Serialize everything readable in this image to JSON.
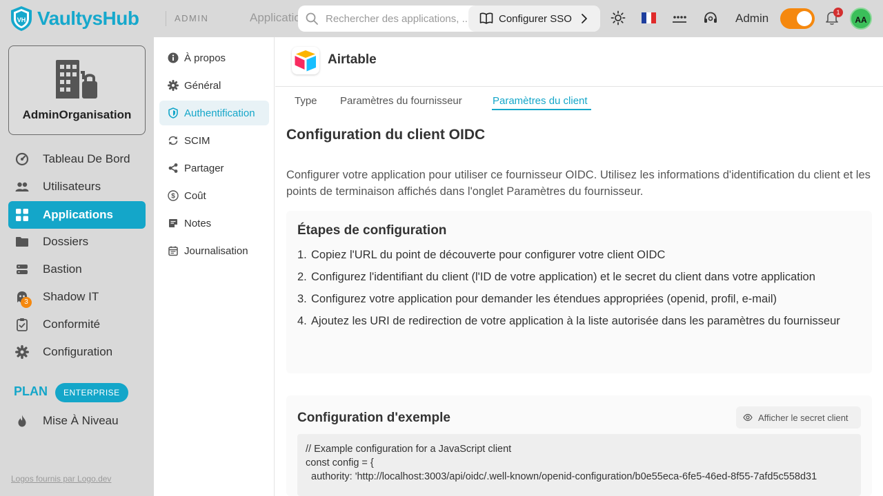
{
  "topbar": {
    "brand": "VaultysHub",
    "section_tag": "ADMIN",
    "breadcrumb": "Applications",
    "search_placeholder": "Rechercher des applications, ...",
    "sso_button": "Configurer SSO",
    "flag": "🇫🇷",
    "user_label": "Admin",
    "notification_count": "1",
    "avatar_initials": "AA",
    "icons": [
      "search-icon",
      "book-icon",
      "chevron-right-icon",
      "sun-icon",
      "france-flag-icon",
      "password-icon",
      "support-icon",
      "bell-icon"
    ]
  },
  "sidebar": {
    "org_name": "AdminOrganisation",
    "items": [
      {
        "label": "Tableau De Bord",
        "icon": "dashboard-icon"
      },
      {
        "label": "Utilisateurs",
        "icon": "users-icon"
      },
      {
        "label": "Applications",
        "icon": "apps-grid-icon",
        "active": true
      },
      {
        "label": "Dossiers",
        "icon": "folder-icon"
      },
      {
        "label": "Bastion",
        "icon": "server-icon"
      },
      {
        "label": "Shadow IT",
        "icon": "ghost-icon",
        "badge": "3"
      },
      {
        "label": "Conformité",
        "icon": "clipboard-icon"
      },
      {
        "label": "Configuration",
        "icon": "gear-icon"
      }
    ],
    "plan_label": "PLAN",
    "plan_badge": "ENTERPRISE",
    "upgrade_label": "Mise À Niveau",
    "logo_credit": "Logos fournis par Logo.dev"
  },
  "subnav": {
    "items": [
      {
        "label": "À propos",
        "icon": "info-icon"
      },
      {
        "label": "Général",
        "icon": "gear-icon"
      },
      {
        "label": "Authentification",
        "icon": "shield-icon",
        "active": true
      },
      {
        "label": "SCIM",
        "icon": "sync-icon"
      },
      {
        "label": "Partager",
        "icon": "share-icon"
      },
      {
        "label": "Coût",
        "icon": "dollar-icon"
      },
      {
        "label": "Notes",
        "icon": "note-icon"
      },
      {
        "label": "Journalisation",
        "icon": "calendar-log-icon"
      }
    ]
  },
  "main": {
    "app_name": "Airtable",
    "tabs": [
      "Type",
      "Paramètres du fournisseur",
      "Paramètres du client"
    ],
    "active_tab": 2,
    "section_title": "Configuration du client OIDC",
    "intro": "Configurer votre application pour utiliser ce fournisseur OIDC. Utilisez les informations d'identification du client et les points de terminaison affichés dans l'onglet Paramètres du fournisseur.",
    "steps_title": "Étapes de configuration",
    "steps": [
      "Copiez l'URL du point de découverte pour configurer votre client OIDC",
      "Configurez l'identifiant du client (l'ID de votre application) et le secret du client dans votre application",
      "Configurez votre application pour demander les étendues appropriées (openid, profil, e-mail)",
      "Ajoutez les URI de redirection de votre application à la liste autorisée dans les paramètres du fournisseur"
    ],
    "example_title": "Configuration d'exemple",
    "show_secret_button": "Afficher le secret client",
    "code_lines": [
      "// Example configuration for a JavaScript client",
      "const config = {",
      "  authority: 'http://localhost:3003/api/oidc/.well-known/openid-configuration/b0e55eca-6fe5-46ed-8f55-7afd5c558d31"
    ]
  },
  "colors": {
    "brand": "#16a8cc",
    "accent_active": "#14a6c9",
    "toggle": "#f5880e",
    "badge_red": "#d32f2f",
    "avatar_green": "#3bbf5a",
    "chrome_gray": "#d9d9d9"
  }
}
